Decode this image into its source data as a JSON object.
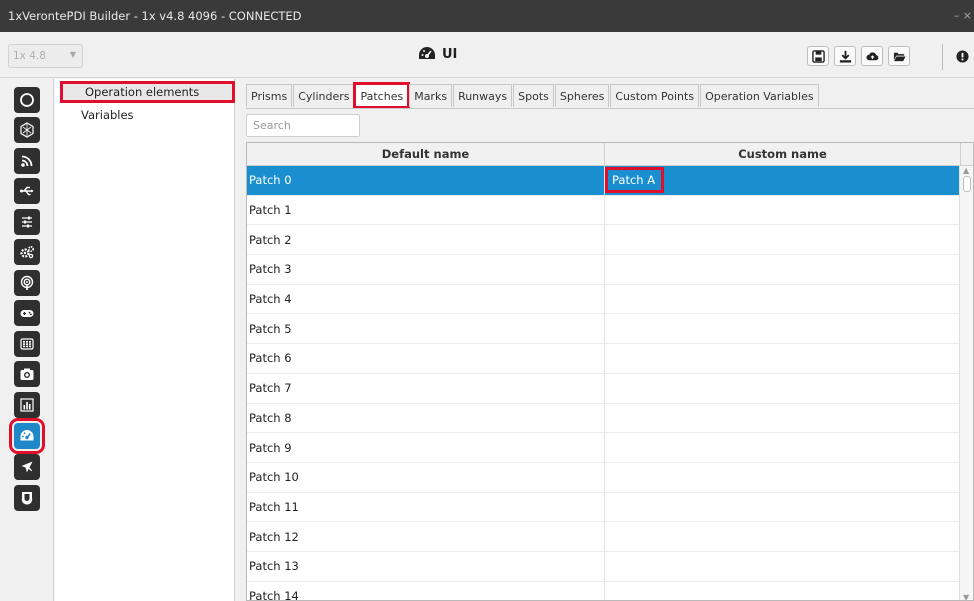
{
  "window": {
    "title": "1xVerontePDI Builder - 1x v4.8 4096 - CONNECTED",
    "controls": "– ×"
  },
  "toolbar": {
    "version_value": "1x 4.8",
    "page_title": "UI",
    "buttons": [
      "save-icon",
      "download-icon",
      "cloud-upload-icon",
      "folder-open-icon",
      "info-icon"
    ]
  },
  "rail": {
    "icons": [
      "power-icon",
      "hexagon-icon",
      "rss-feed-icon",
      "usb-icon",
      "sliders-icon",
      "gears-icon",
      "broadcast-icon",
      "gamepad-icon",
      "keypad-icon",
      "camera-icon",
      "bar-chart-icon",
      "dashboard-icon",
      "airplane-icon",
      "shield-icon"
    ],
    "active": "dashboard-icon",
    "active_color": "#1e88c8"
  },
  "tree": {
    "items": [
      {
        "label": "Operation elements",
        "selected": true
      },
      {
        "label": "Variables",
        "selected": false
      }
    ]
  },
  "tabs": [
    {
      "label": "Prisms"
    },
    {
      "label": "Cylinders"
    },
    {
      "label": "Patches",
      "active": true
    },
    {
      "label": "Marks"
    },
    {
      "label": "Runways"
    },
    {
      "label": "Spots"
    },
    {
      "label": "Spheres"
    },
    {
      "label": "Custom Points"
    },
    {
      "label": "Operation Variables"
    }
  ],
  "search": {
    "placeholder": "Search"
  },
  "table": {
    "headers": [
      "Default name",
      "Custom name"
    ],
    "rows": [
      {
        "default": "Patch 0",
        "custom": "Patch A",
        "selected": true
      },
      {
        "default": "Patch 1",
        "custom": ""
      },
      {
        "default": "Patch 2",
        "custom": ""
      },
      {
        "default": "Patch 3",
        "custom": ""
      },
      {
        "default": "Patch 4",
        "custom": ""
      },
      {
        "default": "Patch 5",
        "custom": ""
      },
      {
        "default": "Patch 6",
        "custom": ""
      },
      {
        "default": "Patch 7",
        "custom": ""
      },
      {
        "default": "Patch 8",
        "custom": ""
      },
      {
        "default": "Patch 9",
        "custom": ""
      },
      {
        "default": "Patch 10",
        "custom": ""
      },
      {
        "default": "Patch 11",
        "custom": ""
      },
      {
        "default": "Patch 12",
        "custom": ""
      },
      {
        "default": "Patch 13",
        "custom": ""
      },
      {
        "default": "Patch 14",
        "custom": ""
      }
    ]
  },
  "colors": {
    "selection": "#1a8fd0",
    "highlight": "#e0102d"
  }
}
